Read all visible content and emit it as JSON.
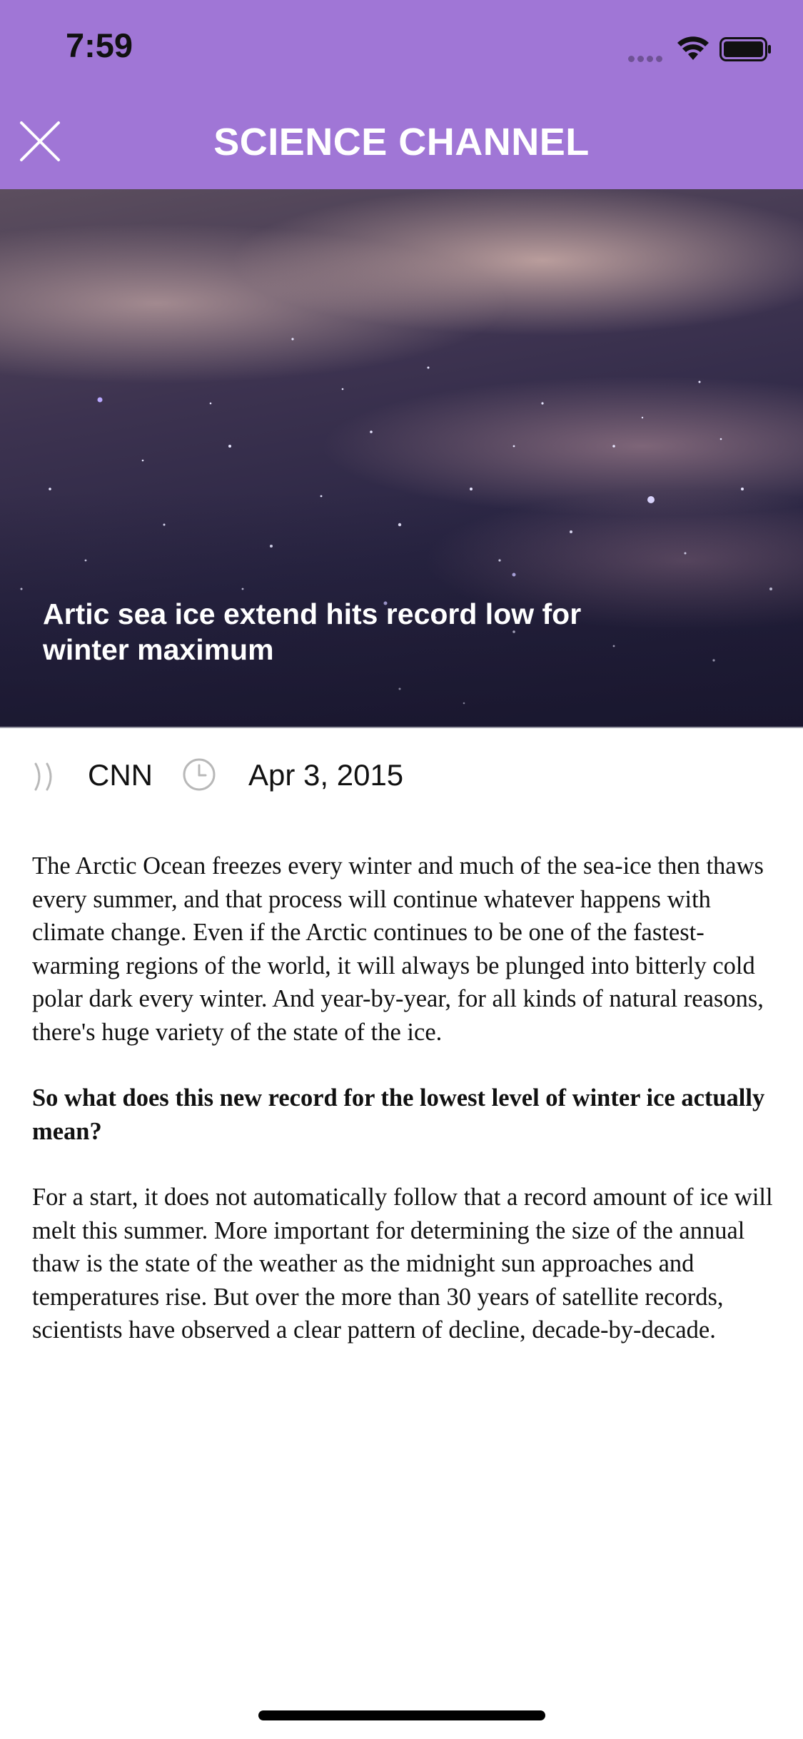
{
  "status_bar": {
    "time": "7:59"
  },
  "header": {
    "title": "SCIENCE CHANNEL",
    "background_color": "#a076d6",
    "close_icon": "close-icon"
  },
  "hero": {
    "title": "Artic sea ice extend hits record low for winter maximum"
  },
  "meta": {
    "source": "CNN",
    "date": "Apr 3, 2015",
    "source_icon": "source-icon",
    "clock_icon": "clock-icon"
  },
  "article": {
    "paragraph_1": "The Arctic Ocean freezes every winter and much of the sea-ice then thaws every summer, and that process will continue whatever happens with climate change. Even if the Arctic continues to be one of the fastest-warming regions of the world, it will always be plunged into bitterly cold polar dark every winter. And year-by-year, for all kinds of natural reasons, there's huge variety of the state of the ice.",
    "question": "So what does this new record for the lowest level of winter ice actually mean?",
    "paragraph_2": "For a start, it does not automatically follow that a record amount of ice will melt this summer. More important for determining the size of the annual thaw is the state of the weather as the midnight sun approaches and temperatures rise. But over the more than 30 years of satellite records, scientists have observed a clear pattern of decline, decade-by-decade."
  }
}
